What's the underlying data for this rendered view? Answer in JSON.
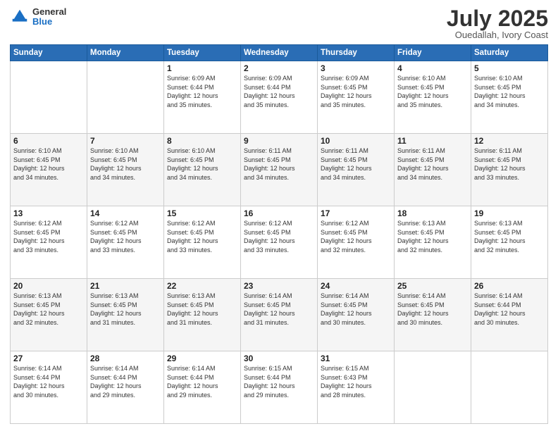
{
  "header": {
    "logo_general": "General",
    "logo_blue": "Blue",
    "month_year": "July 2025",
    "location": "Ouedallah, Ivory Coast"
  },
  "weekdays": [
    "Sunday",
    "Monday",
    "Tuesday",
    "Wednesday",
    "Thursday",
    "Friday",
    "Saturday"
  ],
  "weeks": [
    [
      {
        "day": "",
        "info": ""
      },
      {
        "day": "",
        "info": ""
      },
      {
        "day": "1",
        "info": "Sunrise: 6:09 AM\nSunset: 6:44 PM\nDaylight: 12 hours\nand 35 minutes."
      },
      {
        "day": "2",
        "info": "Sunrise: 6:09 AM\nSunset: 6:44 PM\nDaylight: 12 hours\nand 35 minutes."
      },
      {
        "day": "3",
        "info": "Sunrise: 6:09 AM\nSunset: 6:45 PM\nDaylight: 12 hours\nand 35 minutes."
      },
      {
        "day": "4",
        "info": "Sunrise: 6:10 AM\nSunset: 6:45 PM\nDaylight: 12 hours\nand 35 minutes."
      },
      {
        "day": "5",
        "info": "Sunrise: 6:10 AM\nSunset: 6:45 PM\nDaylight: 12 hours\nand 34 minutes."
      }
    ],
    [
      {
        "day": "6",
        "info": "Sunrise: 6:10 AM\nSunset: 6:45 PM\nDaylight: 12 hours\nand 34 minutes."
      },
      {
        "day": "7",
        "info": "Sunrise: 6:10 AM\nSunset: 6:45 PM\nDaylight: 12 hours\nand 34 minutes."
      },
      {
        "day": "8",
        "info": "Sunrise: 6:10 AM\nSunset: 6:45 PM\nDaylight: 12 hours\nand 34 minutes."
      },
      {
        "day": "9",
        "info": "Sunrise: 6:11 AM\nSunset: 6:45 PM\nDaylight: 12 hours\nand 34 minutes."
      },
      {
        "day": "10",
        "info": "Sunrise: 6:11 AM\nSunset: 6:45 PM\nDaylight: 12 hours\nand 34 minutes."
      },
      {
        "day": "11",
        "info": "Sunrise: 6:11 AM\nSunset: 6:45 PM\nDaylight: 12 hours\nand 34 minutes."
      },
      {
        "day": "12",
        "info": "Sunrise: 6:11 AM\nSunset: 6:45 PM\nDaylight: 12 hours\nand 33 minutes."
      }
    ],
    [
      {
        "day": "13",
        "info": "Sunrise: 6:12 AM\nSunset: 6:45 PM\nDaylight: 12 hours\nand 33 minutes."
      },
      {
        "day": "14",
        "info": "Sunrise: 6:12 AM\nSunset: 6:45 PM\nDaylight: 12 hours\nand 33 minutes."
      },
      {
        "day": "15",
        "info": "Sunrise: 6:12 AM\nSunset: 6:45 PM\nDaylight: 12 hours\nand 33 minutes."
      },
      {
        "day": "16",
        "info": "Sunrise: 6:12 AM\nSunset: 6:45 PM\nDaylight: 12 hours\nand 33 minutes."
      },
      {
        "day": "17",
        "info": "Sunrise: 6:12 AM\nSunset: 6:45 PM\nDaylight: 12 hours\nand 32 minutes."
      },
      {
        "day": "18",
        "info": "Sunrise: 6:13 AM\nSunset: 6:45 PM\nDaylight: 12 hours\nand 32 minutes."
      },
      {
        "day": "19",
        "info": "Sunrise: 6:13 AM\nSunset: 6:45 PM\nDaylight: 12 hours\nand 32 minutes."
      }
    ],
    [
      {
        "day": "20",
        "info": "Sunrise: 6:13 AM\nSunset: 6:45 PM\nDaylight: 12 hours\nand 32 minutes."
      },
      {
        "day": "21",
        "info": "Sunrise: 6:13 AM\nSunset: 6:45 PM\nDaylight: 12 hours\nand 31 minutes."
      },
      {
        "day": "22",
        "info": "Sunrise: 6:13 AM\nSunset: 6:45 PM\nDaylight: 12 hours\nand 31 minutes."
      },
      {
        "day": "23",
        "info": "Sunrise: 6:14 AM\nSunset: 6:45 PM\nDaylight: 12 hours\nand 31 minutes."
      },
      {
        "day": "24",
        "info": "Sunrise: 6:14 AM\nSunset: 6:45 PM\nDaylight: 12 hours\nand 30 minutes."
      },
      {
        "day": "25",
        "info": "Sunrise: 6:14 AM\nSunset: 6:45 PM\nDaylight: 12 hours\nand 30 minutes."
      },
      {
        "day": "26",
        "info": "Sunrise: 6:14 AM\nSunset: 6:44 PM\nDaylight: 12 hours\nand 30 minutes."
      }
    ],
    [
      {
        "day": "27",
        "info": "Sunrise: 6:14 AM\nSunset: 6:44 PM\nDaylight: 12 hours\nand 30 minutes."
      },
      {
        "day": "28",
        "info": "Sunrise: 6:14 AM\nSunset: 6:44 PM\nDaylight: 12 hours\nand 29 minutes."
      },
      {
        "day": "29",
        "info": "Sunrise: 6:14 AM\nSunset: 6:44 PM\nDaylight: 12 hours\nand 29 minutes."
      },
      {
        "day": "30",
        "info": "Sunrise: 6:15 AM\nSunset: 6:44 PM\nDaylight: 12 hours\nand 29 minutes."
      },
      {
        "day": "31",
        "info": "Sunrise: 6:15 AM\nSunset: 6:43 PM\nDaylight: 12 hours\nand 28 minutes."
      },
      {
        "day": "",
        "info": ""
      },
      {
        "day": "",
        "info": ""
      }
    ]
  ]
}
